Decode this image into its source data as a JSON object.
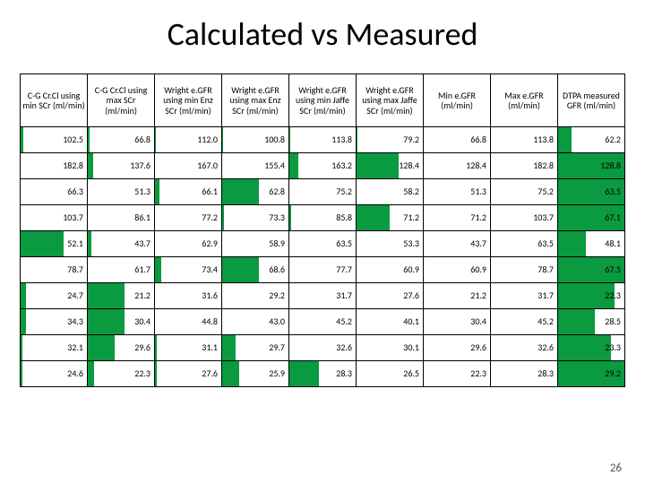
{
  "title": "Calculated vs Measured",
  "page_number": "26",
  "headers": [
    "C-G Cr.Cl using min SCr (ml/min)",
    "C-G Cr.Cl using max SCr (ml/min)",
    "Wright e.GFR using min Enz SCr (ml/min)",
    "Wright e.GFR using max Enz SCr (ml/min)",
    "Wright e.GFR using min Jaffe SCr  (ml/min)",
    "Wright e.GFR using max Jaffe SCr  (ml/min)",
    "Min e.GFR (ml/min)",
    "Max e.GFR (ml/min)",
    "DTPA measured GFR (ml/min)"
  ],
  "chart_data": {
    "type": "table",
    "title": "Calculated vs Measured",
    "columns": [
      "C-G Cr.Cl using min SCr (ml/min)",
      "C-G Cr.Cl using max SCr (ml/min)",
      "Wright e.GFR using min Enz SCr (ml/min)",
      "Wright e.GFR using max Enz SCr (ml/min)",
      "Wright e.GFR using min Jaffe SCr (ml/min)",
      "Wright e.GFR using max Jaffe SCr (ml/min)",
      "Min e.GFR (ml/min)",
      "Max e.GFR (ml/min)",
      "DTPA measured GFR (ml/min)"
    ],
    "rows": [
      [
        102.5,
        66.8,
        112.0,
        100.8,
        113.8,
        79.2,
        66.8,
        113.8,
        62.2
      ],
      [
        182.8,
        137.6,
        167.0,
        155.4,
        163.2,
        128.4,
        128.4,
        182.8,
        128.8
      ],
      [
        66.3,
        51.3,
        66.1,
        62.8,
        75.2,
        58.2,
        51.3,
        75.2,
        63.5
      ],
      [
        103.7,
        86.1,
        77.2,
        73.3,
        85.8,
        71.2,
        71.2,
        103.7,
        67.1
      ],
      [
        52.1,
        43.7,
        62.9,
        58.9,
        63.5,
        53.3,
        43.7,
        63.5,
        48.1
      ],
      [
        78.7,
        61.7,
        73.4,
        68.6,
        77.7,
        60.9,
        60.9,
        78.7,
        67.5
      ],
      [
        24.7,
        21.2,
        31.6,
        29.2,
        31.7,
        27.6,
        21.2,
        31.7,
        22.3
      ],
      [
        34.3,
        30.4,
        44.8,
        43.0,
        45.2,
        40.1,
        30.4,
        45.2,
        28.5
      ],
      [
        32.1,
        29.6,
        31.1,
        29.7,
        32.6,
        30.1,
        29.6,
        32.6,
        23.3
      ],
      [
        24.6,
        22.3,
        27.6,
        25.9,
        28.3,
        26.5,
        22.3,
        28.3,
        29.2
      ]
    ],
    "bar_fraction": [
      [
        0.04,
        0.03,
        0.02,
        0.02,
        0.02,
        0.02,
        0.0,
        0.0,
        0.2
      ],
      [
        0.0,
        0.08,
        0.0,
        0.0,
        0.14,
        0.64,
        0.0,
        0.0,
        1.0
      ],
      [
        0.0,
        0.0,
        0.07,
        0.55,
        0.0,
        0.0,
        0.0,
        0.0,
        1.0
      ],
      [
        0.0,
        0.0,
        0.0,
        0.03,
        0.03,
        0.5,
        0.0,
        0.0,
        1.0
      ],
      [
        0.65,
        0.05,
        0.0,
        0.0,
        0.0,
        0.0,
        0.0,
        0.0,
        0.42
      ],
      [
        0.0,
        0.0,
        0.1,
        0.55,
        0.0,
        0.0,
        0.0,
        0.0,
        1.0
      ],
      [
        0.08,
        0.55,
        0.0,
        0.0,
        0.0,
        0.0,
        0.0,
        0.0,
        0.85
      ],
      [
        0.08,
        0.55,
        0.0,
        0.0,
        0.0,
        0.0,
        0.0,
        0.0,
        0.55
      ],
      [
        0.03,
        0.4,
        0.03,
        0.2,
        0.0,
        0.0,
        0.0,
        0.0,
        0.8
      ],
      [
        0.03,
        0.1,
        0.03,
        0.25,
        0.45,
        0.0,
        0.0,
        0.0,
        1.0
      ]
    ]
  }
}
